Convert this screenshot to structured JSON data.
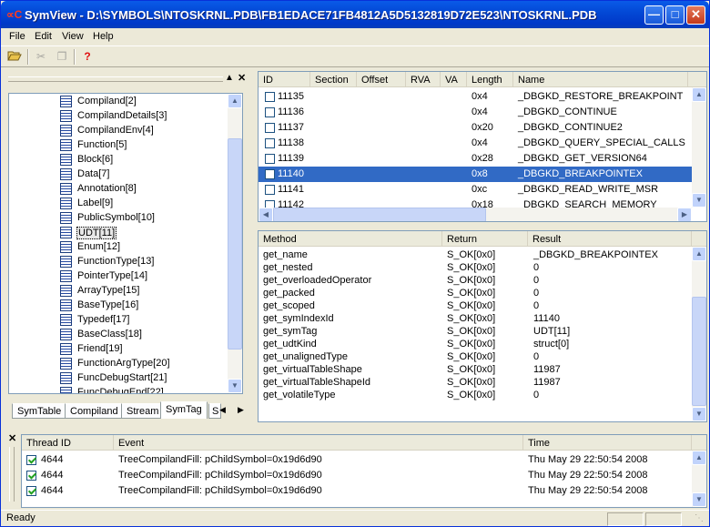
{
  "window": {
    "title": "SymView  -  D:\\SYMBOLS\\NTOSKRNL.PDB\\FB1EDACE71FB4812A5D5132819D72E523\\NTOSKRNL.PDB",
    "app_glyph": "∝C",
    "minimize_icon": "minimize-icon",
    "maximize_icon": "maximize-icon",
    "close_icon": "close-icon"
  },
  "menu": {
    "file": "File",
    "edit": "Edit",
    "view": "View",
    "help": "Help"
  },
  "toolbar": {
    "open_icon": "open-folder-icon",
    "cut_icon": "cut-icon",
    "copy_icon": "copy-icon",
    "help_icon": "help-icon",
    "help_glyph": "?"
  },
  "tree": {
    "items": [
      "Compiland[2]",
      "CompilandDetails[3]",
      "CompilandEnv[4]",
      "Function[5]",
      "Block[6]",
      "Data[7]",
      "Annotation[8]",
      "Label[9]",
      "PublicSymbol[10]",
      "UDT[11]",
      "Enum[12]",
      "FunctionType[13]",
      "PointerType[14]",
      "ArrayType[15]",
      "BaseType[16]",
      "Typedef[17]",
      "BaseClass[18]",
      "Friend[19]",
      "FunctionArgType[20]",
      "FuncDebugStart[21]",
      "FuncDebugEnd[22]"
    ],
    "selected": "UDT[11]"
  },
  "tabs": [
    "SymTable",
    "Compiland",
    "Stream",
    "SymTag",
    "S"
  ],
  "active_tab": "SymTag",
  "symbols": {
    "columns": [
      "ID",
      "Section",
      "Offset",
      "RVA",
      "VA",
      "Length",
      "Name"
    ],
    "rows": [
      {
        "id": "11135",
        "length": "0x4",
        "name": "_DBGKD_RESTORE_BREAKPOINT",
        "selected": false
      },
      {
        "id": "11136",
        "length": "0x4",
        "name": "_DBGKD_CONTINUE",
        "selected": false
      },
      {
        "id": "11137",
        "length": "0x20",
        "name": "_DBGKD_CONTINUE2",
        "selected": false
      },
      {
        "id": "11138",
        "length": "0x4",
        "name": "_DBGKD_QUERY_SPECIAL_CALLS",
        "selected": false
      },
      {
        "id": "11139",
        "length": "0x28",
        "name": "_DBGKD_GET_VERSION64",
        "selected": false
      },
      {
        "id": "11140",
        "length": "0x8",
        "name": "_DBGKD_BREAKPOINTEX",
        "selected": true
      },
      {
        "id": "11141",
        "length": "0xc",
        "name": "_DBGKD_READ_WRITE_MSR",
        "selected": false
      },
      {
        "id": "11142",
        "length": "0x18",
        "name": "_DBGKD_SEARCH_MEMORY",
        "selected": false
      }
    ]
  },
  "methods": {
    "columns": [
      "Method",
      "Return",
      "Result"
    ],
    "rows": [
      {
        "method": "get_name",
        "ret": "S_OK[0x0]",
        "result": "_DBGKD_BREAKPOINTEX"
      },
      {
        "method": "get_nested",
        "ret": "S_OK[0x0]",
        "result": "0"
      },
      {
        "method": "get_overloadedOperator",
        "ret": "S_OK[0x0]",
        "result": "0"
      },
      {
        "method": "get_packed",
        "ret": "S_OK[0x0]",
        "result": "0"
      },
      {
        "method": "get_scoped",
        "ret": "S_OK[0x0]",
        "result": "0"
      },
      {
        "method": "get_symIndexId",
        "ret": "S_OK[0x0]",
        "result": "11140"
      },
      {
        "method": "get_symTag",
        "ret": "S_OK[0x0]",
        "result": "UDT[11]"
      },
      {
        "method": "get_udtKind",
        "ret": "S_OK[0x0]",
        "result": "struct[0]"
      },
      {
        "method": "get_unalignedType",
        "ret": "S_OK[0x0]",
        "result": "0"
      },
      {
        "method": "get_virtualTableShape",
        "ret": "S_OK[0x0]",
        "result": "11987"
      },
      {
        "method": "get_virtualTableShapeId",
        "ret": "S_OK[0x0]",
        "result": "11987"
      },
      {
        "method": "get_volatileType",
        "ret": "S_OK[0x0]",
        "result": "0"
      }
    ]
  },
  "log": {
    "columns": [
      "Thread ID",
      "Event",
      "Time"
    ],
    "rows": [
      {
        "thread": "4644",
        "event": "TreeCompilandFill: pChildSymbol=0x19d6d90",
        "time": "Thu May 29 22:50:54 2008"
      },
      {
        "thread": "4644",
        "event": "TreeCompilandFill: pChildSymbol=0x19d6d90",
        "time": "Thu May 29 22:50:54 2008"
      },
      {
        "thread": "4644",
        "event": "TreeCompilandFill: pChildSymbol=0x19d6d90",
        "time": "Thu May 29 22:50:54 2008"
      }
    ]
  },
  "status": {
    "text": "Ready"
  },
  "colors": {
    "selection": "#316ac5",
    "titlebar": "#0349d6",
    "chrome": "#ece9d8"
  }
}
